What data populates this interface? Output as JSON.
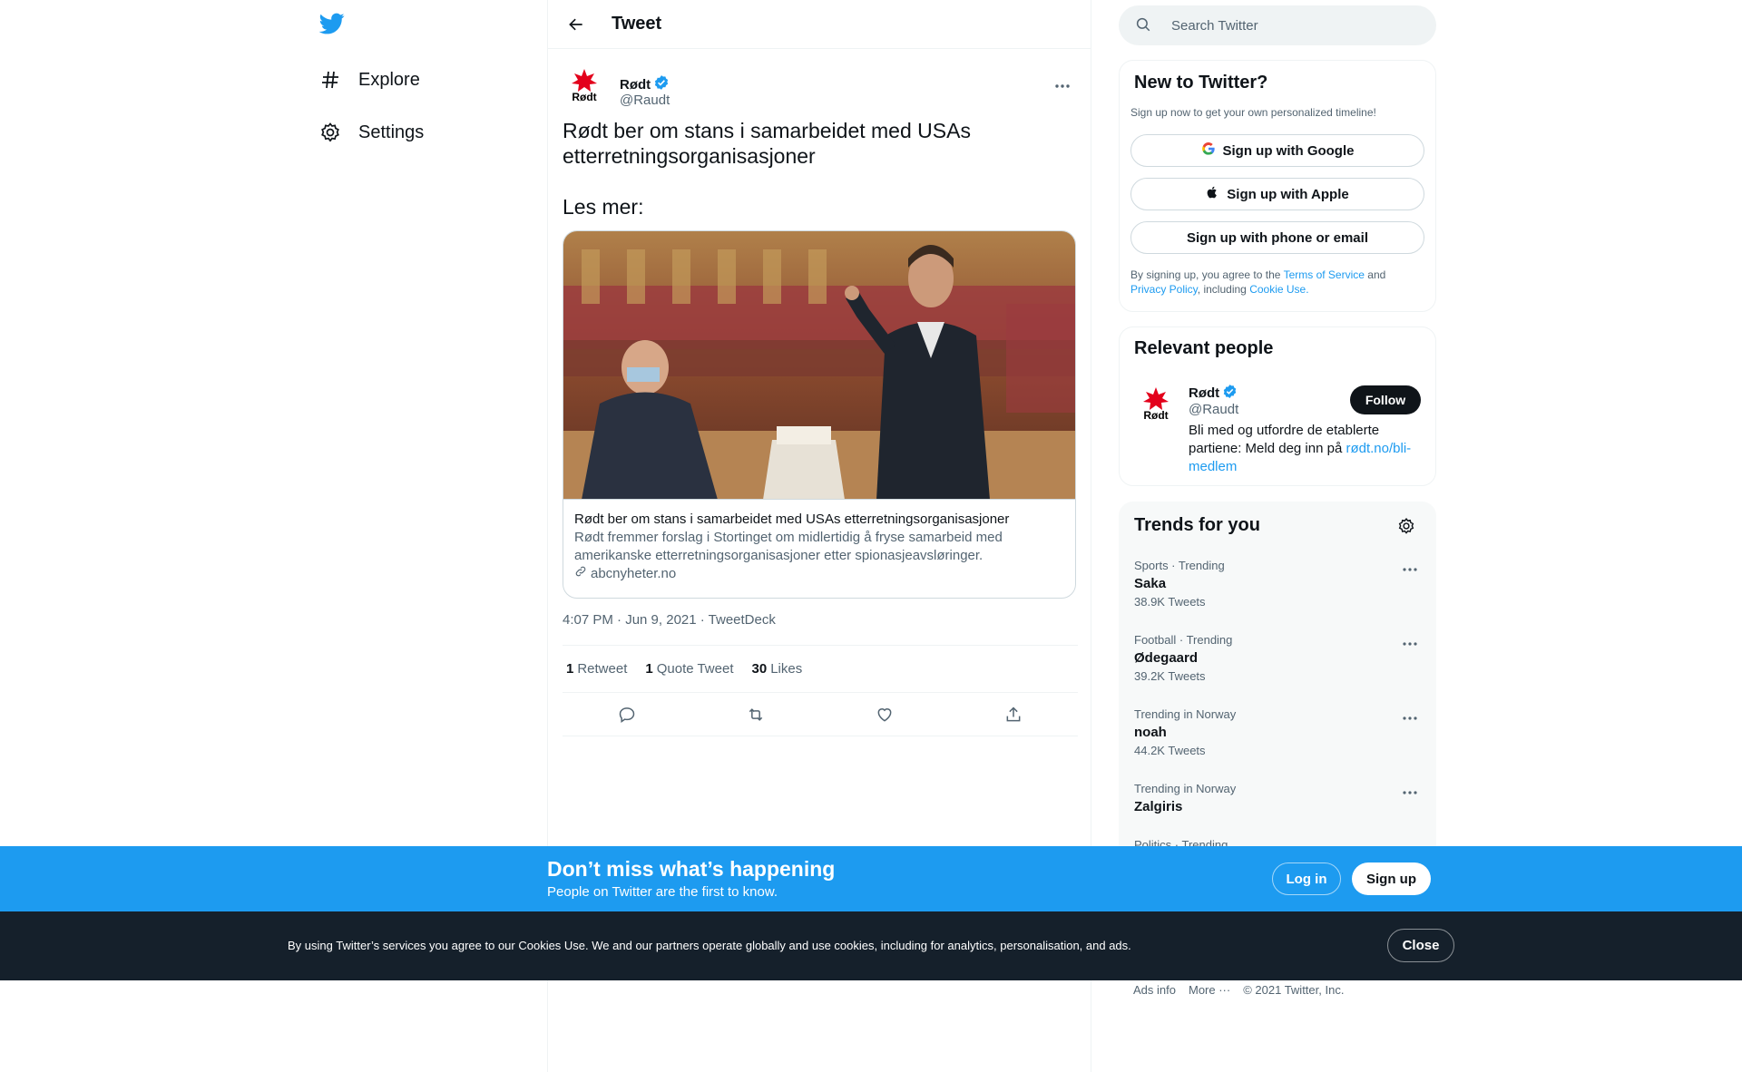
{
  "nav": {
    "items": [
      {
        "label": "Explore",
        "icon": "hashtag-icon"
      },
      {
        "label": "Settings",
        "icon": "gear-icon"
      }
    ]
  },
  "header": {
    "title": "Tweet"
  },
  "tweet": {
    "author": {
      "name": "Rødt",
      "handle": "@Raudt",
      "avatar_text": "Rødt",
      "verified": true
    },
    "text_line1": "Rødt ber om stans i samarbeidet med USAs etterretningsorganisasjoner",
    "text_line2": "Les mer:",
    "card": {
      "title": "Rødt ber om stans i samarbeidet med USAs etterretningsorganisasjoner",
      "description": "Rødt fremmer forslag i Stortinget om midlertidig å fryse samarbeid med amerikanske etterretningsorganisasjoner etter spionasjeavsløringer.",
      "domain": "abcnyheter.no"
    },
    "meta": "4:07 PM · Jun 9, 2021 · TweetDeck",
    "stats": {
      "retweets_count": "1",
      "retweets_label": "Retweet",
      "quotes_count": "1",
      "quotes_label": "Quote Tweet",
      "likes_count": "30",
      "likes_label": "Likes"
    }
  },
  "search": {
    "placeholder": "Search Twitter"
  },
  "signup_panel": {
    "title": "New to Twitter?",
    "subtitle": "Sign up now to get your own personalized timeline!",
    "google": "Sign up with Google",
    "apple": "Sign up with Apple",
    "phone": "Sign up with phone or email",
    "legal_1": "By signing up, you agree to the",
    "terms": "Terms of Service",
    "and": "and",
    "privacy": "Privacy Policy",
    "including": ", including",
    "cookie": "Cookie Use."
  },
  "relevant": {
    "title": "Relevant people",
    "name": "Rødt",
    "handle": "@Raudt",
    "follow": "Follow",
    "bio": "Bli med og utfordre de etablerte partiene: Meld deg inn på",
    "bio_link": "rødt.no/bli-medlem"
  },
  "trends": {
    "title": "Trends for you",
    "items": [
      {
        "context": "Sports · Trending",
        "name": "Saka",
        "count": "38.9K Tweets"
      },
      {
        "context": "Football · Trending",
        "name": "Ødegaard",
        "count": "39.2K Tweets"
      },
      {
        "context": "Trending in Norway",
        "name": "noah",
        "count": "44.2K Tweets"
      },
      {
        "context": "Trending in Norway",
        "name": "Zalgiris",
        "count": ""
      },
      {
        "context": "Politics · Trending",
        "name": "",
        "count": ""
      }
    ]
  },
  "footer": {
    "ads": "Ads info",
    "more": "More ···",
    "copyright": "© 2021 Twitter, Inc."
  },
  "banner": {
    "title": "Don’t miss what’s happening",
    "subtitle": "People on Twitter are the first to know.",
    "login": "Log in",
    "signup": "Sign up"
  },
  "cookies": {
    "text": "By using Twitter’s services you agree to our Cookies Use. We and our partners operate globally and use cookies, including for analytics, personalisation, and ads.",
    "close": "Close"
  },
  "colors": {
    "accent": "#1d9bf0",
    "text": "#0f1419",
    "muted": "#536471",
    "dark": "#15202b"
  }
}
